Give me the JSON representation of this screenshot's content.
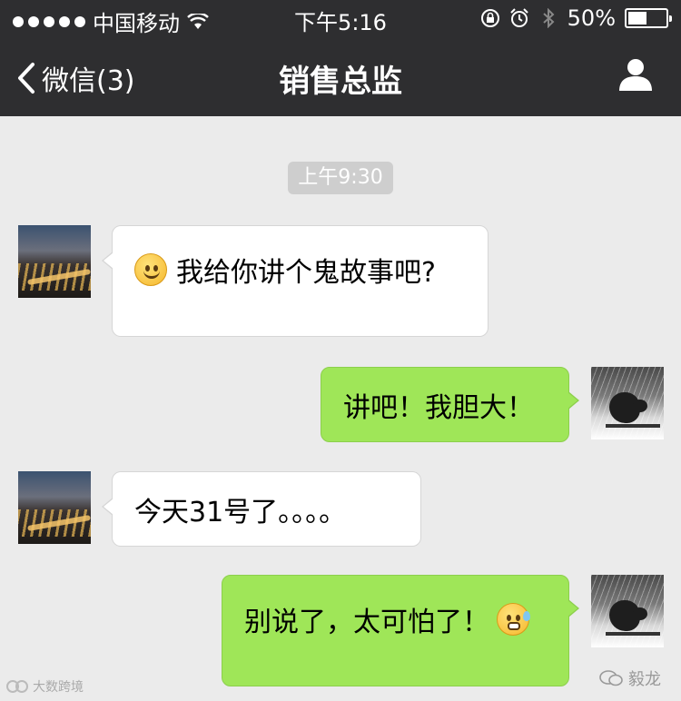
{
  "status_bar": {
    "carrier": "中国移动",
    "time": "下午5:16",
    "battery": "50%",
    "battery_level": 0.5
  },
  "nav": {
    "back_label": "微信(3)",
    "title": "销售总监"
  },
  "chat": {
    "timestamp": "上午9:30",
    "messages": [
      {
        "side": "in",
        "text": "我给你讲个鬼故事吧?",
        "emoji": "smile-icon"
      },
      {
        "side": "out",
        "text": "讲吧！我胆大！"
      },
      {
        "side": "in",
        "text": "今天31号了。。。。"
      },
      {
        "side": "out",
        "text": "别说了，太可怕了！",
        "emoji": "scared-icon"
      }
    ]
  },
  "watermarks": {
    "left": "大数跨境",
    "right": "毅龙"
  }
}
